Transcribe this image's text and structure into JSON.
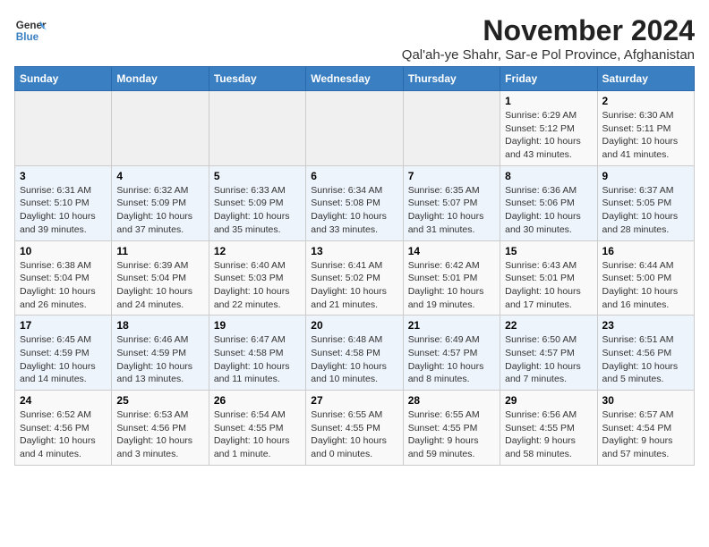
{
  "header": {
    "logo_line1": "General",
    "logo_line2": "Blue",
    "title": "November 2024",
    "subtitle": "Qal'ah-ye Shahr, Sar-e Pol Province, Afghanistan"
  },
  "weekdays": [
    "Sunday",
    "Monday",
    "Tuesday",
    "Wednesday",
    "Thursday",
    "Friday",
    "Saturday"
  ],
  "weeks": [
    [
      {
        "day": "",
        "detail": ""
      },
      {
        "day": "",
        "detail": ""
      },
      {
        "day": "",
        "detail": ""
      },
      {
        "day": "",
        "detail": ""
      },
      {
        "day": "",
        "detail": ""
      },
      {
        "day": "1",
        "detail": "Sunrise: 6:29 AM\nSunset: 5:12 PM\nDaylight: 10 hours and 43 minutes."
      },
      {
        "day": "2",
        "detail": "Sunrise: 6:30 AM\nSunset: 5:11 PM\nDaylight: 10 hours and 41 minutes."
      }
    ],
    [
      {
        "day": "3",
        "detail": "Sunrise: 6:31 AM\nSunset: 5:10 PM\nDaylight: 10 hours and 39 minutes."
      },
      {
        "day": "4",
        "detail": "Sunrise: 6:32 AM\nSunset: 5:09 PM\nDaylight: 10 hours and 37 minutes."
      },
      {
        "day": "5",
        "detail": "Sunrise: 6:33 AM\nSunset: 5:09 PM\nDaylight: 10 hours and 35 minutes."
      },
      {
        "day": "6",
        "detail": "Sunrise: 6:34 AM\nSunset: 5:08 PM\nDaylight: 10 hours and 33 minutes."
      },
      {
        "day": "7",
        "detail": "Sunrise: 6:35 AM\nSunset: 5:07 PM\nDaylight: 10 hours and 31 minutes."
      },
      {
        "day": "8",
        "detail": "Sunrise: 6:36 AM\nSunset: 5:06 PM\nDaylight: 10 hours and 30 minutes."
      },
      {
        "day": "9",
        "detail": "Sunrise: 6:37 AM\nSunset: 5:05 PM\nDaylight: 10 hours and 28 minutes."
      }
    ],
    [
      {
        "day": "10",
        "detail": "Sunrise: 6:38 AM\nSunset: 5:04 PM\nDaylight: 10 hours and 26 minutes."
      },
      {
        "day": "11",
        "detail": "Sunrise: 6:39 AM\nSunset: 5:04 PM\nDaylight: 10 hours and 24 minutes."
      },
      {
        "day": "12",
        "detail": "Sunrise: 6:40 AM\nSunset: 5:03 PM\nDaylight: 10 hours and 22 minutes."
      },
      {
        "day": "13",
        "detail": "Sunrise: 6:41 AM\nSunset: 5:02 PM\nDaylight: 10 hours and 21 minutes."
      },
      {
        "day": "14",
        "detail": "Sunrise: 6:42 AM\nSunset: 5:01 PM\nDaylight: 10 hours and 19 minutes."
      },
      {
        "day": "15",
        "detail": "Sunrise: 6:43 AM\nSunset: 5:01 PM\nDaylight: 10 hours and 17 minutes."
      },
      {
        "day": "16",
        "detail": "Sunrise: 6:44 AM\nSunset: 5:00 PM\nDaylight: 10 hours and 16 minutes."
      }
    ],
    [
      {
        "day": "17",
        "detail": "Sunrise: 6:45 AM\nSunset: 4:59 PM\nDaylight: 10 hours and 14 minutes."
      },
      {
        "day": "18",
        "detail": "Sunrise: 6:46 AM\nSunset: 4:59 PM\nDaylight: 10 hours and 13 minutes."
      },
      {
        "day": "19",
        "detail": "Sunrise: 6:47 AM\nSunset: 4:58 PM\nDaylight: 10 hours and 11 minutes."
      },
      {
        "day": "20",
        "detail": "Sunrise: 6:48 AM\nSunset: 4:58 PM\nDaylight: 10 hours and 10 minutes."
      },
      {
        "day": "21",
        "detail": "Sunrise: 6:49 AM\nSunset: 4:57 PM\nDaylight: 10 hours and 8 minutes."
      },
      {
        "day": "22",
        "detail": "Sunrise: 6:50 AM\nSunset: 4:57 PM\nDaylight: 10 hours and 7 minutes."
      },
      {
        "day": "23",
        "detail": "Sunrise: 6:51 AM\nSunset: 4:56 PM\nDaylight: 10 hours and 5 minutes."
      }
    ],
    [
      {
        "day": "24",
        "detail": "Sunrise: 6:52 AM\nSunset: 4:56 PM\nDaylight: 10 hours and 4 minutes."
      },
      {
        "day": "25",
        "detail": "Sunrise: 6:53 AM\nSunset: 4:56 PM\nDaylight: 10 hours and 3 minutes."
      },
      {
        "day": "26",
        "detail": "Sunrise: 6:54 AM\nSunset: 4:55 PM\nDaylight: 10 hours and 1 minute."
      },
      {
        "day": "27",
        "detail": "Sunrise: 6:55 AM\nSunset: 4:55 PM\nDaylight: 10 hours and 0 minutes."
      },
      {
        "day": "28",
        "detail": "Sunrise: 6:55 AM\nSunset: 4:55 PM\nDaylight: 9 hours and 59 minutes."
      },
      {
        "day": "29",
        "detail": "Sunrise: 6:56 AM\nSunset: 4:55 PM\nDaylight: 9 hours and 58 minutes."
      },
      {
        "day": "30",
        "detail": "Sunrise: 6:57 AM\nSunset: 4:54 PM\nDaylight: 9 hours and 57 minutes."
      }
    ]
  ]
}
